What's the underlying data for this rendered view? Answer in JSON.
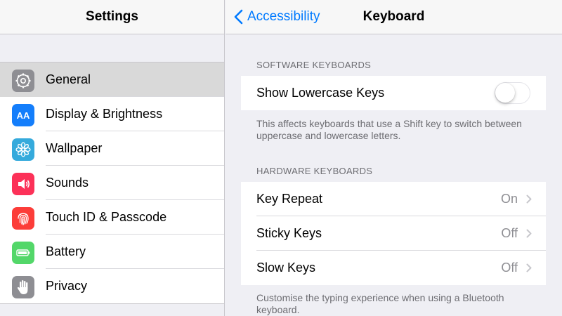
{
  "sidebar": {
    "title": "Settings",
    "items": [
      {
        "label": "General",
        "icon": "gear-icon",
        "color": "#8e8e93",
        "selected": true
      },
      {
        "label": "Display & Brightness",
        "icon": "text-size-icon",
        "color": "#147efb"
      },
      {
        "label": "Wallpaper",
        "icon": "flower-icon",
        "color": "#35aadc"
      },
      {
        "label": "Sounds",
        "icon": "speaker-icon",
        "color": "#fc3158"
      },
      {
        "label": "Touch ID & Passcode",
        "icon": "fingerprint-icon",
        "color": "#fc3d39"
      },
      {
        "label": "Battery",
        "icon": "battery-icon",
        "color": "#53d769"
      },
      {
        "label": "Privacy",
        "icon": "hand-icon",
        "color": "#8e8e93"
      }
    ],
    "display_icon_text": "AA"
  },
  "detail": {
    "back_label": "Accessibility",
    "title": "Keyboard",
    "software_section": "SOFTWARE KEYBOARDS",
    "lowercase_label": "Show Lowercase Keys",
    "lowercase_enabled": false,
    "software_footer": "This affects keyboards that use a Shift key to switch between uppercase and lowercase letters.",
    "hardware_section": "HARDWARE KEYBOARDS",
    "hardware_rows": [
      {
        "label": "Key Repeat",
        "value": "On"
      },
      {
        "label": "Sticky Keys",
        "value": "Off"
      },
      {
        "label": "Slow Keys",
        "value": "Off"
      }
    ],
    "hardware_footer": "Customise the typing experience when using a Bluetooth keyboard."
  },
  "colors": {
    "accent": "#007aff"
  }
}
